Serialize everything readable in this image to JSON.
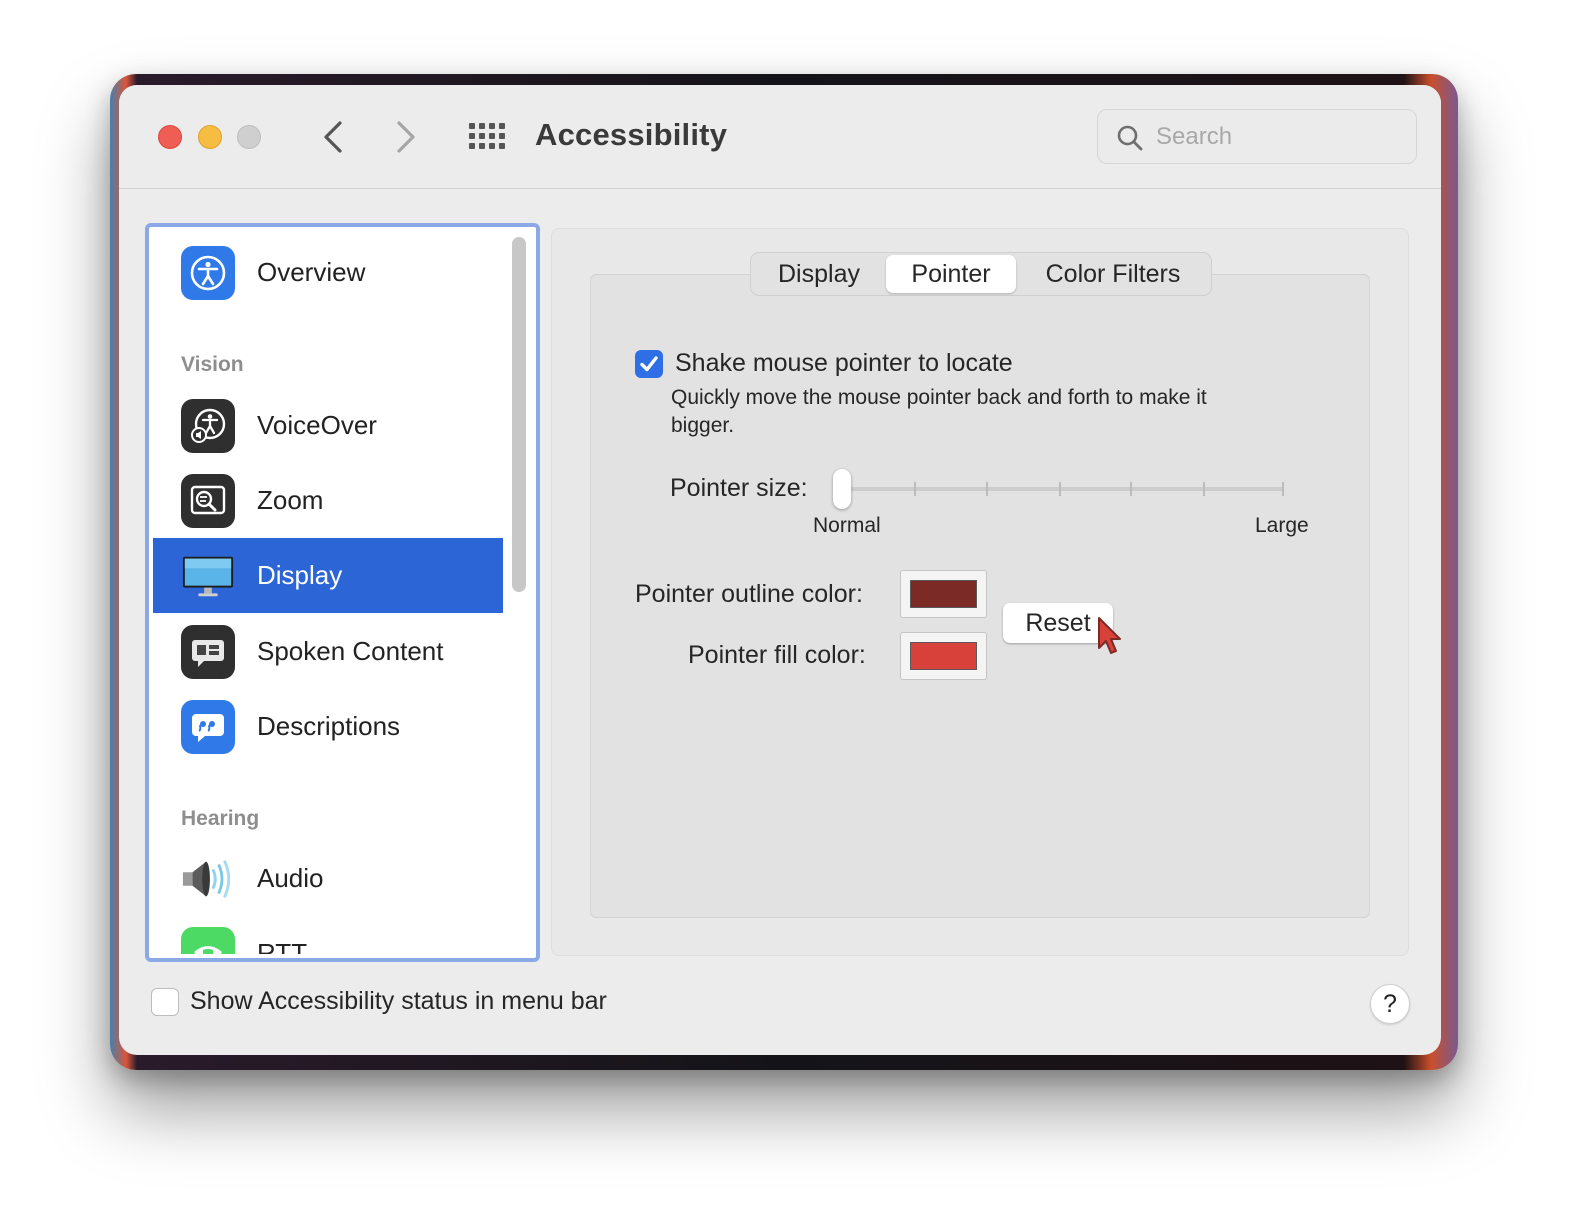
{
  "window": {
    "title": "Accessibility",
    "search_placeholder": "Search"
  },
  "sidebar": {
    "items": [
      {
        "label": "Overview",
        "icon": "accessibility-icon"
      },
      {
        "label": "VoiceOver",
        "icon": "voiceover-icon"
      },
      {
        "label": "Zoom",
        "icon": "zoom-icon"
      },
      {
        "label": "Display",
        "icon": "display-icon",
        "selected": true
      },
      {
        "label": "Spoken Content",
        "icon": "spoken-content-icon"
      },
      {
        "label": "Descriptions",
        "icon": "descriptions-icon"
      },
      {
        "label": "Audio",
        "icon": "speaker-icon"
      },
      {
        "label": "RTT",
        "icon": "rtt-phone-icon"
      }
    ],
    "sections": {
      "vision": "Vision",
      "hearing": "Hearing"
    }
  },
  "tabs": [
    {
      "label": "Display"
    },
    {
      "label": "Pointer",
      "active": true
    },
    {
      "label": "Color Filters"
    }
  ],
  "pointer": {
    "shake_label": "Shake mouse pointer to locate",
    "shake_checked": true,
    "shake_description": "Quickly move the mouse pointer back and forth to make it bigger.",
    "size_label": "Pointer size:",
    "size_min_label": "Normal",
    "size_max_label": "Large",
    "size_value": 0,
    "outline_label": "Pointer outline color:",
    "outline_color": "#7b2a26",
    "fill_label": "Pointer fill color:",
    "fill_color": "#d8403a",
    "reset_label": "Reset"
  },
  "footer": {
    "status_label": "Show Accessibility status in menu bar",
    "status_checked": false,
    "help_label": "?"
  },
  "colors": {
    "accent": "#2c65d6",
    "checkbox": "#2e6fe6"
  }
}
